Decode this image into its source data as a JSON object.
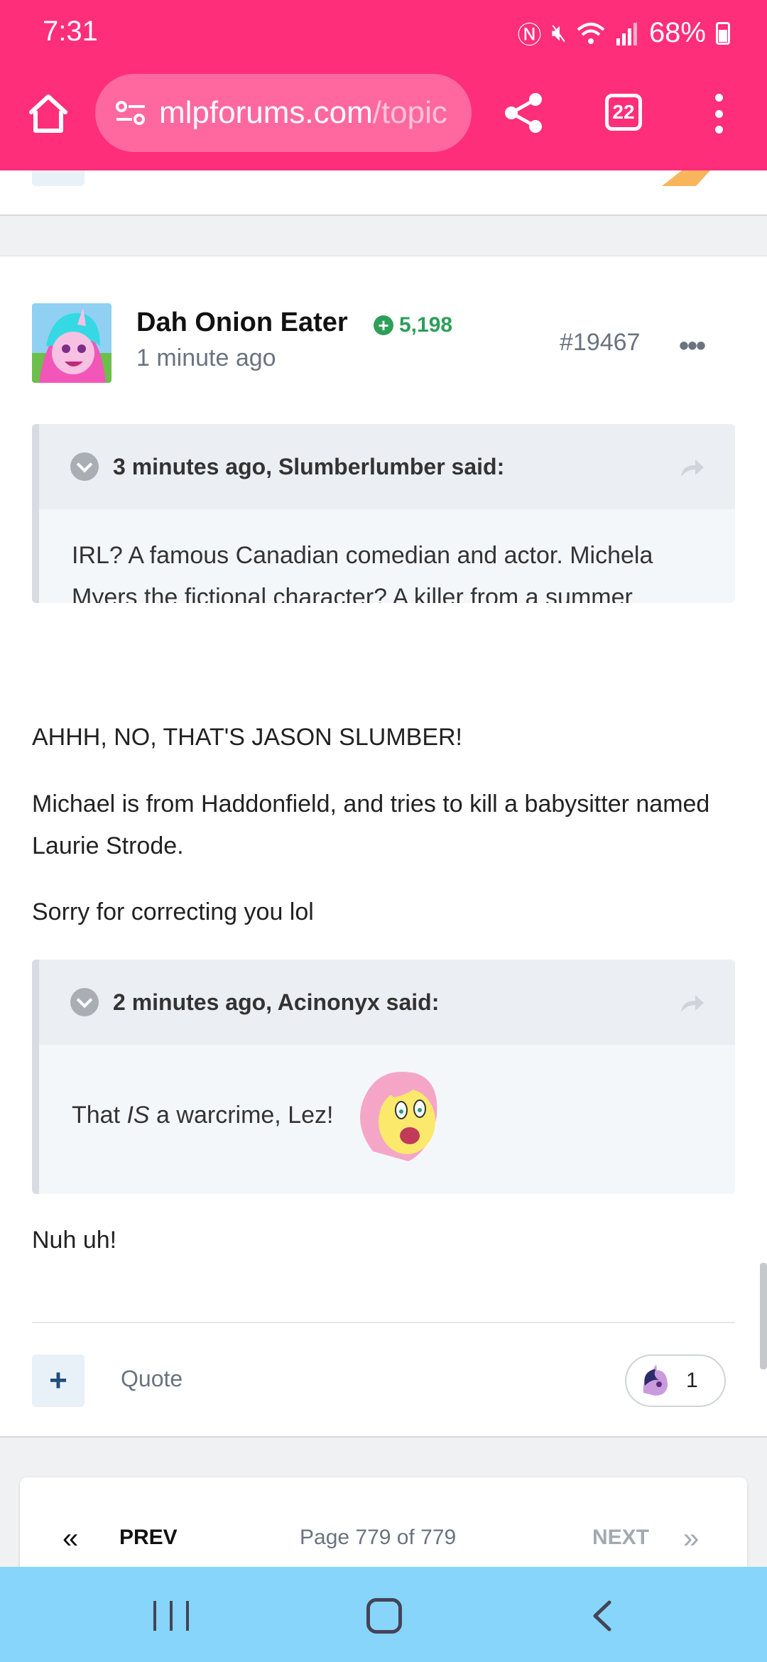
{
  "status": {
    "time": "7:31",
    "battery": "68%"
  },
  "browser": {
    "url_main": "mlpforums.com",
    "url_dim": "/topic",
    "tab_count": "22"
  },
  "post": {
    "author": "Dah Onion Eater",
    "reputation": "5,198",
    "time": "1 minute ago",
    "number": "#19467",
    "more": "•••",
    "quote1": {
      "cite": "3 minutes ago, Slumberlumber said:",
      "text": "IRL? A famous Canadian comedian and actor. Michela Myers the fictional character? A killer from a summer camp."
    },
    "para1": "AHHH, NO, THAT'S JASON SLUMBER!",
    "para2": "Michael is from Haddonfield, and tries to kill a babysitter named Laurie Strode.",
    "para3": "Sorry for correcting you lol",
    "quote2": {
      "cite": "2 minutes ago, Acinonyx said:",
      "text_before": "That ",
      "text_em": "IS",
      "text_after": " a warcrime, Lez!"
    },
    "para4": "Nuh uh!",
    "actions": {
      "plus": "+",
      "quote": "Quote",
      "reaction_count": "1"
    }
  },
  "pagination": {
    "first": "«",
    "prev": "PREV",
    "info": "Page 779 of 779",
    "next": "NEXT",
    "last": "»"
  }
}
